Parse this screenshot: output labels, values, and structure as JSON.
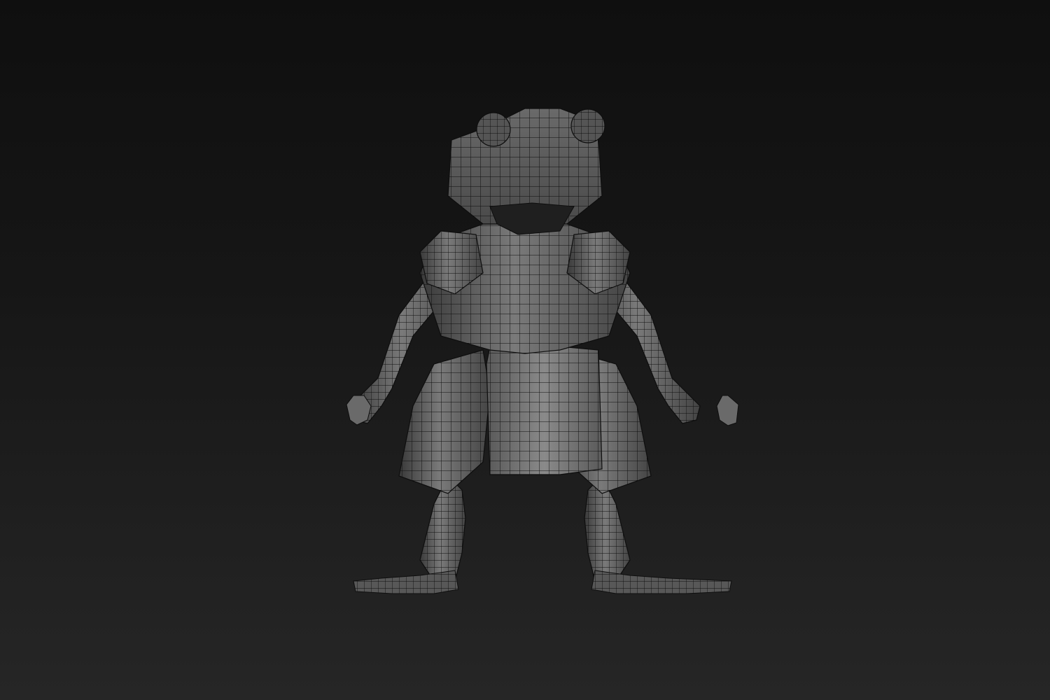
{
  "viewport": {
    "background_top": "#0f0f0f",
    "background_bottom": "#262626"
  },
  "model": {
    "subject": "frog-character-wireframe",
    "shading": "gray-flat-with-wire",
    "body_color": "#5b5b5b",
    "highlight_color": "#8a8a8a",
    "shadow_color": "#262626",
    "wire_color": "#0e0e0e"
  }
}
